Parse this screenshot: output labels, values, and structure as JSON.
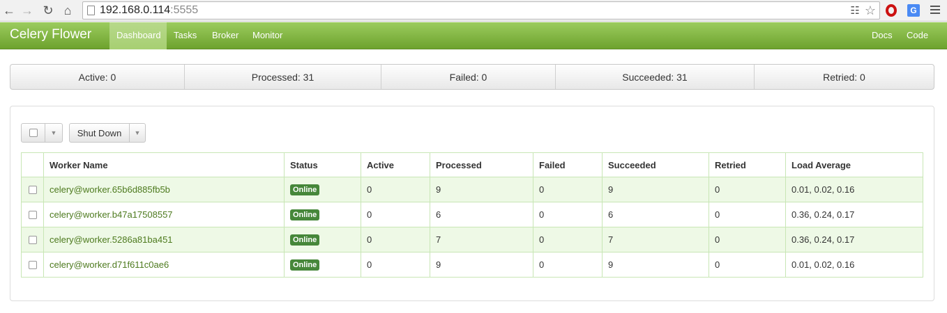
{
  "browser": {
    "url_host": "192.168.0.114",
    "url_port": ":5555"
  },
  "navbar": {
    "brand": "Celery Flower",
    "items": [
      "Dashboard",
      "Tasks",
      "Broker",
      "Monitor"
    ],
    "right_items": [
      "Docs",
      "Code"
    ],
    "active": "Dashboard"
  },
  "stats": [
    {
      "label": "Active: 0"
    },
    {
      "label": "Processed: 31"
    },
    {
      "label": "Failed: 0"
    },
    {
      "label": "Succeeded: 31"
    },
    {
      "label": "Retried: 0"
    }
  ],
  "toolbar": {
    "shutdown_label": "Shut Down"
  },
  "table": {
    "headers": [
      "Worker Name",
      "Status",
      "Active",
      "Processed",
      "Failed",
      "Succeeded",
      "Retried",
      "Load Average"
    ],
    "rows": [
      {
        "name": "celery@worker.65b6d885fb5b",
        "status": "Online",
        "active": "0",
        "processed": "9",
        "failed": "0",
        "succeeded": "9",
        "retried": "0",
        "load": "0.01, 0.02, 0.16"
      },
      {
        "name": "celery@worker.b47a17508557",
        "status": "Online",
        "active": "0",
        "processed": "6",
        "failed": "0",
        "succeeded": "6",
        "retried": "0",
        "load": "0.36, 0.24, 0.17"
      },
      {
        "name": "celery@worker.5286a81ba451",
        "status": "Online",
        "active": "0",
        "processed": "7",
        "failed": "0",
        "succeeded": "7",
        "retried": "0",
        "load": "0.36, 0.24, 0.17"
      },
      {
        "name": "celery@worker.d71f611c0ae6",
        "status": "Online",
        "active": "0",
        "processed": "9",
        "failed": "0",
        "succeeded": "9",
        "retried": "0",
        "load": "0.01, 0.02, 0.16"
      }
    ]
  },
  "colors": {
    "navbar_green": "#7db23e",
    "badge_green": "#46873a",
    "link_green": "#4d7a1e"
  }
}
